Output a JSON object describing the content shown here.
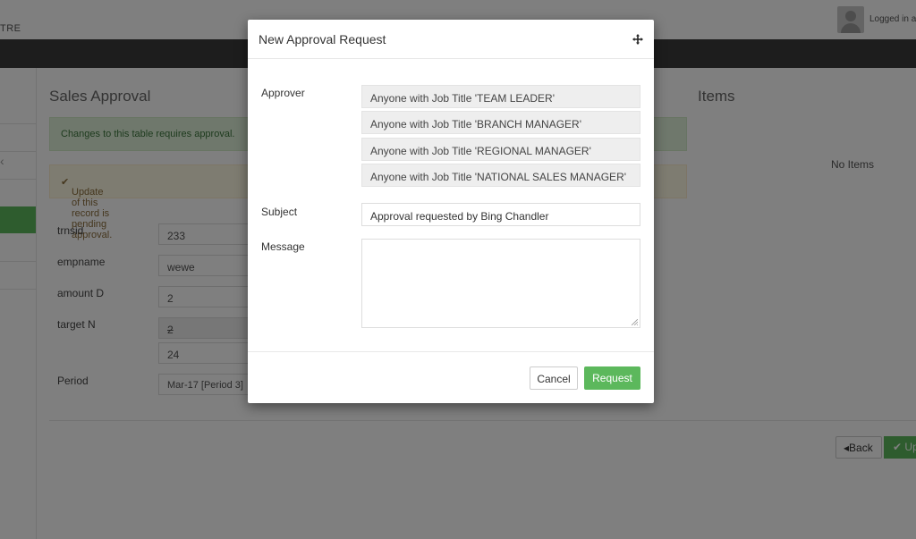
{
  "app": {
    "brand": "TRE",
    "logged_in_text": "Logged in as"
  },
  "page": {
    "title": "Sales Approval",
    "items_title": "Items",
    "no_items": "No Items",
    "alert_info": "Changes to this table requires approval.",
    "alert_pending": "Update of this record is pending approval.",
    "fields": [
      {
        "label": "trnsid",
        "value": "233"
      },
      {
        "label": "empname",
        "value": "wewe"
      },
      {
        "label": "amount D",
        "value": "2"
      },
      {
        "label": "target N",
        "value": "2",
        "value2": "24"
      },
      {
        "label": "Period",
        "value": "Mar-17 [Period 3]"
      }
    ],
    "back_label": "Back",
    "update_label": "Up"
  },
  "modal": {
    "title": "New Approval Request",
    "approver_label": "Approver",
    "approvers": [
      "Anyone with Job Title 'TEAM LEADER'",
      "Anyone with Job Title 'BRANCH MANAGER'",
      "Anyone with Job Title 'REGIONAL MANAGER'",
      "Anyone with Job Title 'NATIONAL SALES MANAGER'"
    ],
    "subject_label": "Subject",
    "subject_value": "Approval requested by Bing Chandler",
    "message_label": "Message",
    "message_value": "",
    "cancel_label": "Cancel",
    "request_label": "Request"
  },
  "colors": {
    "accent_green": "#5cb85c",
    "navbar": "#3a3a3a"
  },
  "icons": {
    "move": "move-icon",
    "check": "check-icon",
    "back": "caret-left-icon"
  }
}
